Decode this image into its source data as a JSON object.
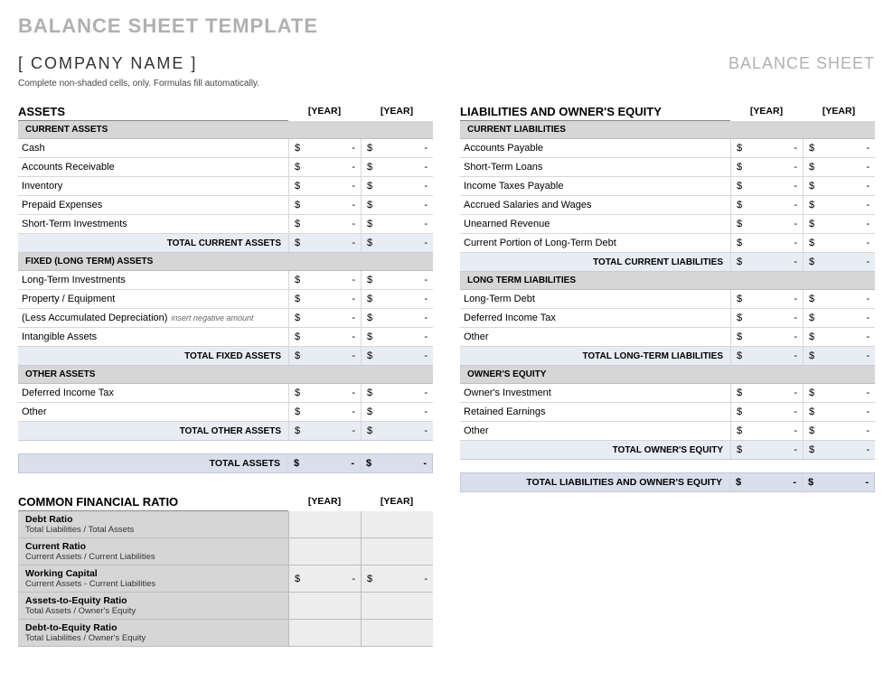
{
  "main_title": "BALANCE SHEET TEMPLATE",
  "company_name": "[ COMPANY NAME ]",
  "doc_title": "BALANCE SHEET",
  "instruction": "Complete non-shaded cells, only.  Formulas fill automatically.",
  "year1_label": "[YEAR]",
  "year2_label": "[YEAR]",
  "currency_symbol": "$",
  "dash": "-",
  "assets": {
    "title": "ASSETS",
    "current": {
      "header": "CURRENT ASSETS",
      "items": [
        "Cash",
        "Accounts Receivable",
        "Inventory",
        "Prepaid Expenses",
        "Short-Term Investments"
      ],
      "subtotal": "TOTAL CURRENT ASSETS"
    },
    "fixed": {
      "header": "FIXED (LONG TERM) ASSETS",
      "items": [
        "Long-Term Investments",
        "Property / Equipment",
        "(Less Accumulated Depreciation)",
        "Intangible Assets"
      ],
      "depreciation_hint": "insert negative amount",
      "subtotal": "TOTAL FIXED ASSETS"
    },
    "other": {
      "header": "OTHER ASSETS",
      "items": [
        "Deferred Income Tax",
        "Other"
      ],
      "subtotal": "TOTAL OTHER ASSETS"
    },
    "grand_total": "TOTAL ASSETS"
  },
  "liabilities_equity": {
    "title": "LIABILITIES AND OWNER'S EQUITY",
    "current": {
      "header": "CURRENT LIABILITIES",
      "items": [
        "Accounts Payable",
        "Short-Term Loans",
        "Income Taxes Payable",
        "Accrued Salaries and Wages",
        "Unearned Revenue",
        "Current Portion of Long-Term Debt"
      ],
      "subtotal": "TOTAL CURRENT LIABILITIES"
    },
    "long_term": {
      "header": "LONG TERM LIABILITIES",
      "items": [
        "Long-Term Debt",
        "Deferred Income Tax",
        "Other"
      ],
      "subtotal": "TOTAL LONG-TERM LIABILITIES"
    },
    "equity": {
      "header": "OWNER'S EQUITY",
      "items": [
        "Owner's Investment",
        "Retained Earnings",
        "Other"
      ],
      "subtotal": "TOTAL OWNER'S EQUITY"
    },
    "grand_total": "TOTAL LIABILITIES AND OWNER'S EQUITY"
  },
  "ratios": {
    "title": "COMMON FINANCIAL RATIO",
    "items": [
      {
        "name": "Debt Ratio",
        "formula": "Total Liabilities / Total Assets",
        "show_currency": false
      },
      {
        "name": "Current Ratio",
        "formula": "Current Assets / Current Liabilities",
        "show_currency": false
      },
      {
        "name": "Working Capital",
        "formula": "Current Assets - Current Liabilities",
        "show_currency": true
      },
      {
        "name": "Assets-to-Equity Ratio",
        "formula": "Total Assets / Owner's Equity",
        "show_currency": false
      },
      {
        "name": "Debt-to-Equity Ratio",
        "formula": "Total Liabilities / Owner's Equity",
        "show_currency": false
      }
    ]
  }
}
